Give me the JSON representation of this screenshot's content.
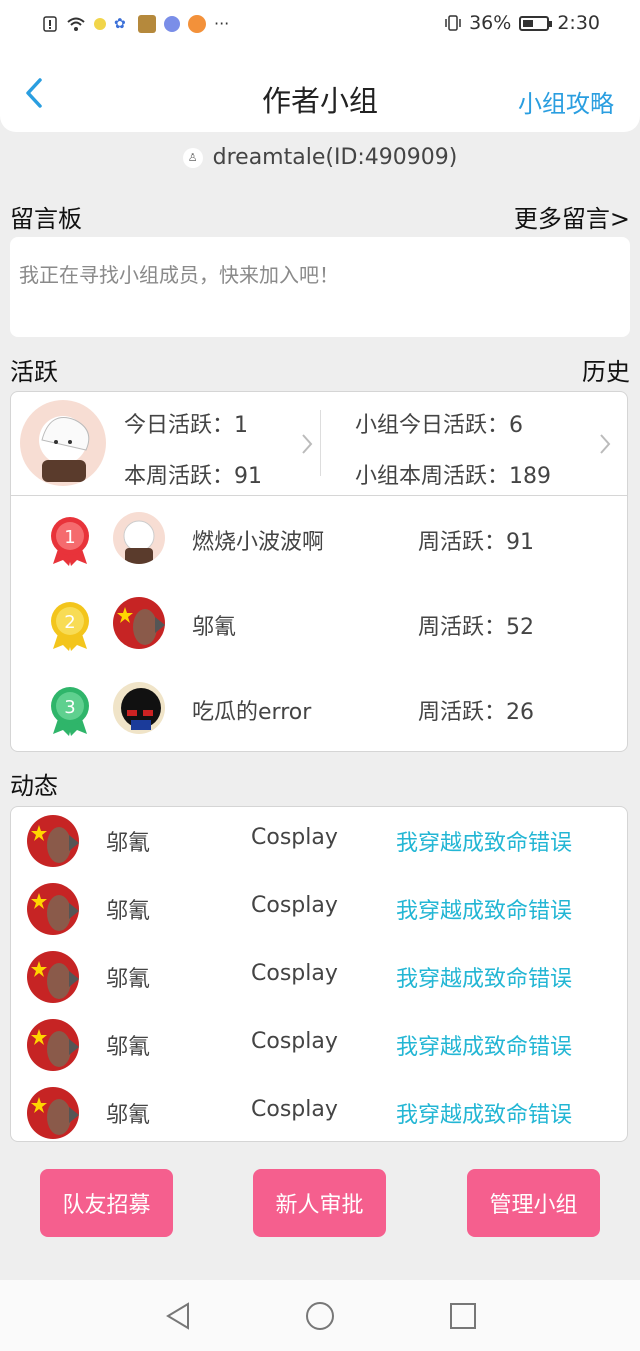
{
  "status_bar": {
    "battery": "36%",
    "time": "2:30",
    "icons": [
      "alert-icon",
      "wifi-icon",
      "app-icon-1",
      "paw-icon",
      "app-icon-2",
      "music-icon",
      "browser-icon",
      "more-dots-icon"
    ]
  },
  "header": {
    "title": "作者小组",
    "right_link": "小组攻略",
    "back_icon": "chevron-left-icon"
  },
  "creator": {
    "name": "dreamtale(ID:490909)"
  },
  "message_board": {
    "label": "留言板",
    "more": "更多留言>",
    "text": "我正在寻找小组成员，快来加入吧！"
  },
  "activity": {
    "label": "活跃",
    "history": "历史",
    "today": "今日活跃：1",
    "week": "本周活跃：91",
    "group_today": "小组今日活跃：6",
    "group_week": "小组本周活跃：189",
    "ranking": [
      {
        "rank": "1",
        "name": "燃烧小波波啊",
        "score": "周活跃：91",
        "color": "#e8333a"
      },
      {
        "rank": "2",
        "name": "邬氰",
        "score": "周活跃：52",
        "color": "#f3c51c"
      },
      {
        "rank": "3",
        "name": "吃瓜的error",
        "score": "周活跃：26",
        "color": "#2fb56a"
      }
    ]
  },
  "feed": {
    "label": "动态",
    "items": [
      {
        "name": "邬氰",
        "category": "Cosplay",
        "work": "我穿越成致命错误"
      },
      {
        "name": "邬氰",
        "category": "Cosplay",
        "work": "我穿越成致命错误"
      },
      {
        "name": "邬氰",
        "category": "Cosplay",
        "work": "我穿越成致命错误"
      },
      {
        "name": "邬氰",
        "category": "Cosplay",
        "work": "我穿越成致命错误"
      },
      {
        "name": "邬氰",
        "category": "Cosplay",
        "work": "我穿越成致命错误"
      }
    ]
  },
  "buttons": {
    "recruit": "队友招募",
    "approve": "新人审批",
    "manage": "管理小组"
  },
  "colors": {
    "accent_blue": "#2a9ee0",
    "link_cyan": "#23b6d4",
    "button_pink": "#f55f8e"
  }
}
